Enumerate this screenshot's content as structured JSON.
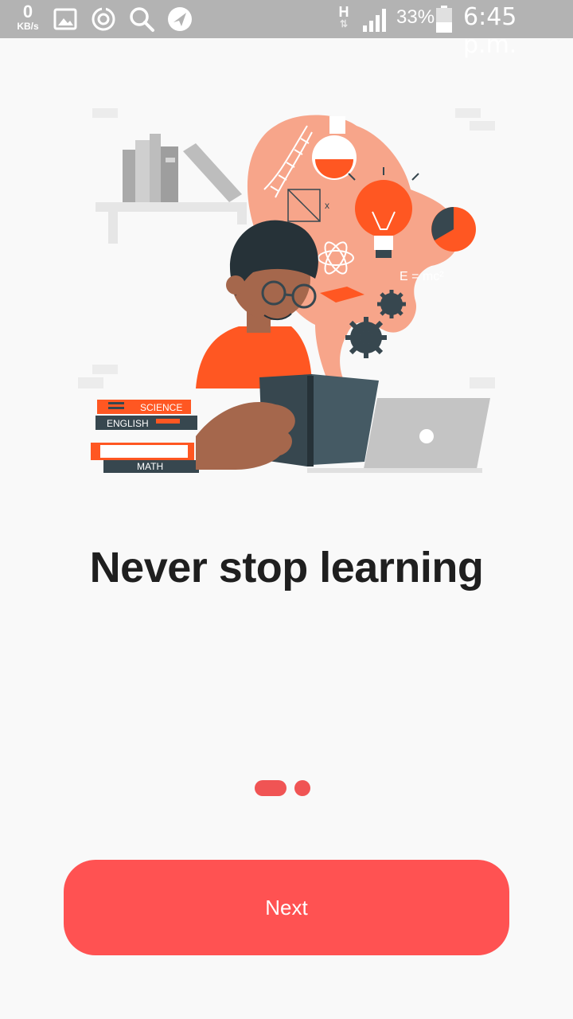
{
  "status_bar": {
    "speed_value": "0",
    "speed_unit": "KB/s",
    "network_type": "H",
    "network_arrows": "⇅",
    "battery_percent": "33%",
    "time": "6:45 p.m.",
    "icons": [
      "gallery-icon",
      "sync-icon",
      "search-icon",
      "browser-icon",
      "signal-icon",
      "battery-icon"
    ]
  },
  "illustration": {
    "books": [
      "SCIENCE",
      "ENGLISH",
      "MATH"
    ],
    "formula": "E = mc²",
    "formula_superscript": "2",
    "chalk_letter": "x"
  },
  "onboarding": {
    "title": "Never stop learning",
    "page_index": 1,
    "page_count": 2
  },
  "actions": {
    "next_label": "Next"
  },
  "colors": {
    "accent": "#ff5252",
    "indicator": "#f05454",
    "orange": "#ff5722",
    "dark": "#37474f",
    "statusbar": "#b3b3b3"
  }
}
